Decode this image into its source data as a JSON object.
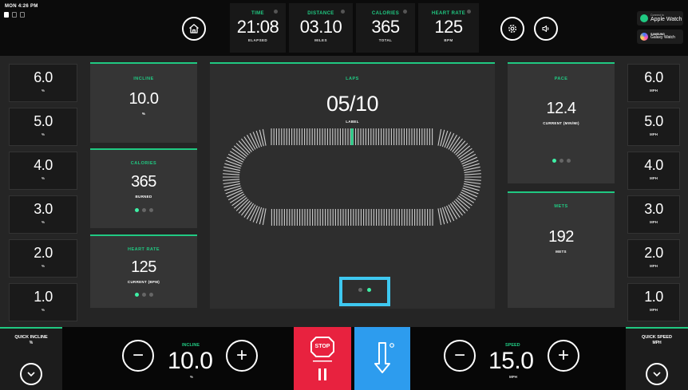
{
  "status": {
    "clock": "MON 4:26 PM"
  },
  "metrics": [
    {
      "label": "TIME",
      "value": "21:08",
      "sub": "ELAPSED"
    },
    {
      "label": "DISTANCE",
      "value": "03.10",
      "sub": "MILES"
    },
    {
      "label": "CALORIES",
      "value": "365",
      "sub": "TOTAL"
    },
    {
      "label": "HEART RATE",
      "value": "125",
      "sub": "BPM"
    }
  ],
  "connections": {
    "apple": {
      "sub": "Connect to",
      "main": "Apple Watch"
    },
    "samsung": {
      "sub": "SAMSUNG",
      "main": "Galaxy Watch"
    }
  },
  "incline_presets": [
    {
      "value": "6.0",
      "unit": "%"
    },
    {
      "value": "5.0",
      "unit": "%"
    },
    {
      "value": "4.0",
      "unit": "%"
    },
    {
      "value": "3.0",
      "unit": "%"
    },
    {
      "value": "2.0",
      "unit": "%"
    },
    {
      "value": "1.0",
      "unit": "%"
    }
  ],
  "speed_presets": [
    {
      "value": "6.0",
      "unit": "MPH"
    },
    {
      "value": "5.0",
      "unit": "MPH"
    },
    {
      "value": "4.0",
      "unit": "MPH"
    },
    {
      "value": "3.0",
      "unit": "MPH"
    },
    {
      "value": "2.0",
      "unit": "MPH"
    },
    {
      "value": "1.0",
      "unit": "MPH"
    }
  ],
  "cards": {
    "incline": {
      "label": "INCLINE",
      "value": "10.0",
      "sub": "%"
    },
    "calories": {
      "label": "CALORIES",
      "value": "365",
      "sub": "BURNED"
    },
    "heart_rate": {
      "label": "HEART RATE",
      "value": "125",
      "sub": "CURRENT (BPM)"
    },
    "laps": {
      "label": "LAPS",
      "value": "05/10",
      "sub": "LABEL"
    },
    "pace": {
      "label": "PACE",
      "value": "12.4",
      "sub": "CURRENT (MIN/MI)"
    },
    "mets": {
      "label": "METS",
      "value": "192",
      "sub": "METS"
    }
  },
  "bottom": {
    "quick_incline": {
      "label": "QUICK INCLINE",
      "sub": "%"
    },
    "quick_speed": {
      "label": "QUICK SPEED",
      "sub": "MPH"
    },
    "incline": {
      "label": "INCLINE",
      "value": "10.0",
      "unit": "%",
      "minus": "−",
      "plus": "+"
    },
    "speed": {
      "label": "SPEED",
      "value": "15.0",
      "unit": "MPH",
      "minus": "−",
      "plus": "+"
    },
    "stop_label": "STOP"
  },
  "colors": {
    "accent": "#20c982",
    "stop": "#e8223f",
    "cooldown": "#2d9cee",
    "highlight": "#3ec8f0"
  }
}
